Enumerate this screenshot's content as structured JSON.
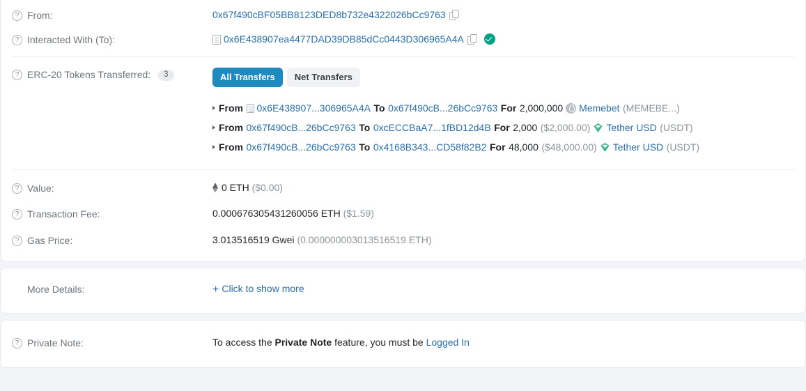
{
  "rows": {
    "from": {
      "label": "From:",
      "address": "0x67f490cBF05BB8123DED8b732e4322026bCc9763"
    },
    "interacted_with": {
      "label": "Interacted With (To):",
      "address": "0x6E438907ea4477DAD39DB85dCc0443D306965A4A"
    },
    "erc20": {
      "label": "ERC-20 Tokens Transferred:",
      "count": "3",
      "tabs": [
        {
          "label": "All Transfers",
          "active": true
        },
        {
          "label": "Net Transfers",
          "active": false
        }
      ],
      "transfers": [
        {
          "from_label": "From",
          "from_addr": "0x6E438907...306965A4A",
          "from_is_contract": true,
          "to_label": "To",
          "to_addr": "0x67f490cB...26bCc9763",
          "for_label": "For",
          "amount": "2,000,000",
          "usd": "",
          "token_name": "Memebet",
          "token_symbol": "(MEMEBE...)",
          "token_icon": "memebet-token-icon"
        },
        {
          "from_label": "From",
          "from_addr": "0x67f490cB...26bCc9763",
          "from_is_contract": false,
          "to_label": "To",
          "to_addr": "0xcECCBaA7...1fBD12d4B",
          "for_label": "For",
          "amount": "2,000",
          "usd": "($2,000.00)",
          "token_name": "Tether USD",
          "token_symbol": "(USDT)",
          "token_icon": "tether-token-icon"
        },
        {
          "from_label": "From",
          "from_addr": "0x67f490cB...26bCc9763",
          "from_is_contract": false,
          "to_label": "To",
          "to_addr": "0x4168B343...CD58f82B2",
          "for_label": "For",
          "amount": "48,000",
          "usd": "($48,000.00)",
          "token_name": "Tether USD",
          "token_symbol": "(USDT)",
          "token_icon": "tether-token-icon"
        }
      ]
    },
    "value": {
      "label": "Value:",
      "amount": "0 ETH",
      "usd": "($0.00)"
    },
    "transaction_fee": {
      "label": "Transaction Fee:",
      "amount": "0.000676305431260056 ETH",
      "usd": "($1.59)"
    },
    "gas_price": {
      "label": "Gas Price:",
      "amount": "3.013516519 Gwei",
      "eth": "(0.000000003013516519 ETH)"
    },
    "more_details": {
      "label": "More Details:",
      "link": "Click to show more",
      "plus": "+"
    },
    "private_note": {
      "label": "Private Note:",
      "text_before": "To access the ",
      "text_bold": "Private Note",
      "text_after": " feature, you must be ",
      "login_link": "Logged In"
    }
  },
  "colors": {
    "link": "#2a6fad",
    "tab_active_bg": "#1f8ac0",
    "verified_green": "#00a186",
    "tether_teal": "#26a17b",
    "muted": "#8c949c"
  }
}
